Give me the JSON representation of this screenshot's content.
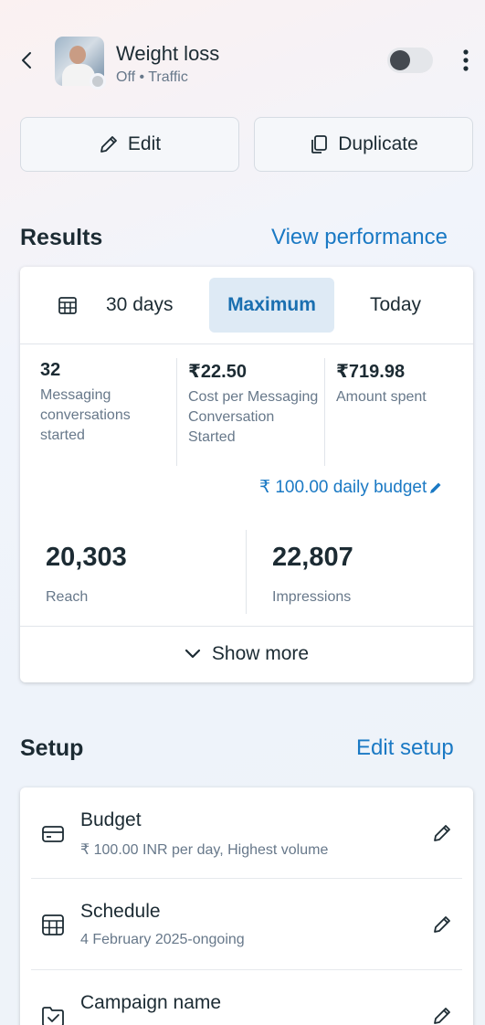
{
  "header": {
    "title": "Weight loss",
    "subtitle": "Off • Traffic",
    "toggle_state": "off"
  },
  "actions": {
    "edit_label": "Edit",
    "duplicate_label": "Duplicate"
  },
  "results": {
    "heading": "Results",
    "link": "View performance",
    "ranges": [
      {
        "label": "30 days"
      },
      {
        "label": "Maximum",
        "selected": true
      },
      {
        "label": "Today"
      }
    ],
    "metrics": [
      {
        "value": "32",
        "label": "Messaging conversations started"
      },
      {
        "value": "₹22.50",
        "label": "Cost per Messaging Conversation Started"
      },
      {
        "value": "₹719.98",
        "label": "Amount spent"
      }
    ],
    "budget_link": "₹ 100.00 daily budget",
    "big_metrics": [
      {
        "value": "20,303",
        "label": "Reach"
      },
      {
        "value": "22,807",
        "label": "Impressions"
      }
    ],
    "show_more": "Show more"
  },
  "setup": {
    "heading": "Setup",
    "link": "Edit setup",
    "items": [
      {
        "name": "Budget",
        "desc": "₹ 100.00 INR per day, Highest volume",
        "icon": "credit-card-icon"
      },
      {
        "name": "Schedule",
        "desc": "4 February 2025-ongoing",
        "icon": "calendar-icon"
      },
      {
        "name": "Campaign name",
        "desc": "",
        "icon": "folder-check-icon"
      }
    ]
  },
  "colors": {
    "accent": "#1a79c4",
    "selected_bg": "#deeaf5",
    "text": "#1c2b33",
    "muted": "#67788a"
  }
}
